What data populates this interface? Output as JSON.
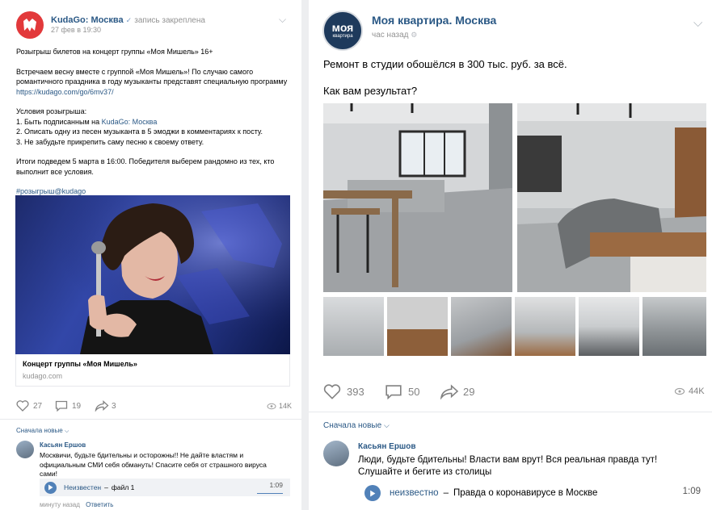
{
  "left_post": {
    "group_name": "KudaGo: Москва",
    "verified_icon": "check-icon",
    "pinned_label": "запись закреплена",
    "date": "27 фев в 19:30",
    "title": "Розыгрыш билетов на концерт группы «Моя Мишель» 16+",
    "p1_line1": "Встречаем весну вместе с группой «Моя Мишель»! По случаю самого",
    "p1_line2": "романтичного праздника в году музыканты представят специальную программу",
    "p1_link": "https://kudago.com/go/6mv37/",
    "cond_title": "Условия розыгрыша:",
    "cond1_prefix": "1. Быть подписанным на ",
    "cond1_link": "KudaGo: Москва",
    "cond2": "2. Описать одну из песен музыканта в 5 эмоджи в комментариях к посту.",
    "cond3": "3. Не забудьте прикрепить саму песню к своему ответу.",
    "final_line1": "Итоги подведем 5 марта в 16:00. Победителя выберем рандомно из тех, кто",
    "final_line2": "выполнит все условия.",
    "hashtag": "#розыгрыш@kudago",
    "card_title": "Концерт группы «Моя Мишель»",
    "card_domain": "kudago.com",
    "likes": "27",
    "comments": "19",
    "shares": "3",
    "views": "14K",
    "sort_label": "Сначала новые",
    "comment": {
      "author": "Касьян Ершов",
      "line1": "Москвичи, будьте бдительны и осторожны!! Не дайте властям и",
      "line2": "официальным СМИ себя обмануть! Спасите себя от страшного вируса",
      "line3": "сами!",
      "audio_artist": "Неизвестен",
      "audio_title": "файл 1",
      "audio_dash": "–",
      "audio_duration": "1:09",
      "time": "минуту назад",
      "reply": "Ответить"
    }
  },
  "right_post": {
    "group_name": "Моя квартира. Москва",
    "avatar_text_1": "моя",
    "avatar_text_2": "квартира",
    "time": "час назад",
    "line1": "Ремонт в студии обошёлся в 300 тыс. руб. за всё.",
    "line2": "Как вам результат?",
    "likes": "393",
    "comments": "50",
    "shares": "29",
    "views": "44K",
    "sort_label": "Сначала новые",
    "comment": {
      "author": "Касьян Ершов",
      "line1": "Люди, будьте бдительны! Власти вам врут! Вся реальная правда тут!",
      "line2": "Слушайте и бегите из столицы",
      "audio_artist": "неизвестно",
      "audio_dash": "–",
      "audio_title": "Правда о коронавирусе в Москве",
      "audio_duration": "1:09"
    }
  },
  "colors": {
    "link": "#2a5885",
    "meta": "#939393",
    "accent": "#5181b8",
    "kudago_red": "#e2393b"
  }
}
